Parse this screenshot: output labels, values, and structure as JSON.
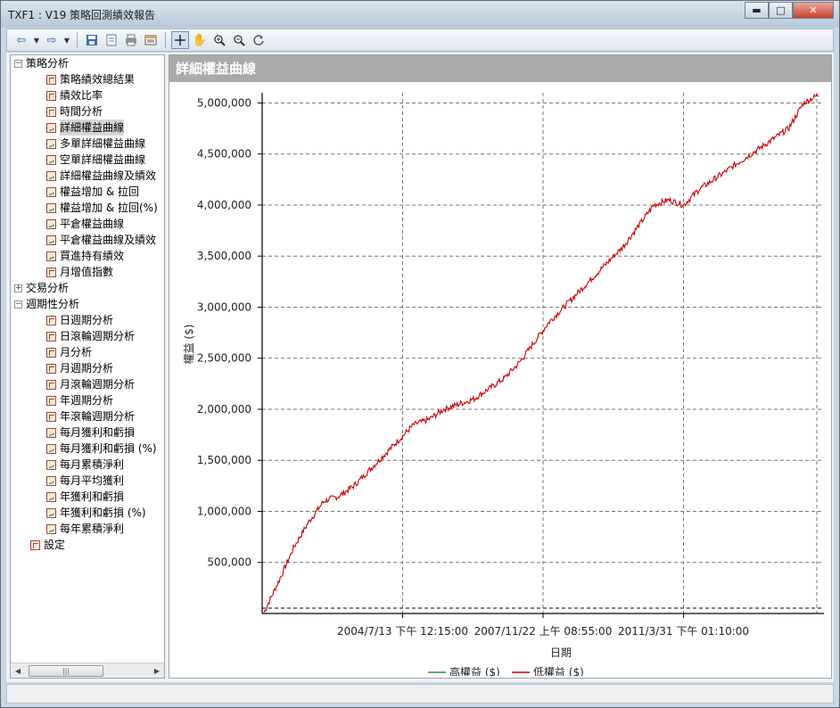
{
  "window": {
    "title": "TXF1 : V19 策略回測績效報告"
  },
  "window_buttons": {
    "minimize": "▬",
    "maximize": "□",
    "close": "✕"
  },
  "toolbar": {
    "icons": [
      "back-icon",
      "forward-icon",
      "save-icon",
      "export-icon",
      "print-icon",
      "settings-icon",
      "crosshair-icon",
      "hand-icon",
      "zoom-in-icon",
      "zoom-out-icon",
      "reset-icon"
    ]
  },
  "tree": {
    "groups": [
      {
        "label": "策略分析",
        "expanded": true,
        "items": [
          {
            "label": "策略績效總結果",
            "icon": "table"
          },
          {
            "label": "績效比率",
            "icon": "table"
          },
          {
            "label": "時間分析",
            "icon": "table"
          },
          {
            "label": "詳細權益曲線",
            "icon": "chart",
            "selected": true
          },
          {
            "label": "多單詳細權益曲線",
            "icon": "chart"
          },
          {
            "label": "空單詳細權益曲線",
            "icon": "chart"
          },
          {
            "label": "詳細權益曲線及績效",
            "icon": "chart"
          },
          {
            "label": "權益增加 & 拉回",
            "icon": "chart"
          },
          {
            "label": "權益增加 & 拉回(%)",
            "icon": "chart"
          },
          {
            "label": "平倉權益曲線",
            "icon": "chart"
          },
          {
            "label": "平倉權益曲線及績效",
            "icon": "chart"
          },
          {
            "label": "買進持有績效",
            "icon": "chart"
          },
          {
            "label": "月增值指數",
            "icon": "table"
          }
        ]
      },
      {
        "label": "交易分析",
        "expanded": false,
        "items": []
      },
      {
        "label": "週期性分析",
        "expanded": true,
        "items": [
          {
            "label": "日週期分析",
            "icon": "table"
          },
          {
            "label": "日滾輪週期分析",
            "icon": "table"
          },
          {
            "label": "月分析",
            "icon": "table"
          },
          {
            "label": "月週期分析",
            "icon": "table"
          },
          {
            "label": "月滾輪週期分析",
            "icon": "table"
          },
          {
            "label": "年週期分析",
            "icon": "table"
          },
          {
            "label": "年滾輪週期分析",
            "icon": "table"
          },
          {
            "label": "每月獲利和虧損",
            "icon": "chart"
          },
          {
            "label": "每月獲利和虧損 (%)",
            "icon": "chart"
          },
          {
            "label": "每月累積淨利",
            "icon": "chart"
          },
          {
            "label": "每月平均獲利",
            "icon": "chart"
          },
          {
            "label": "年獲利和虧損",
            "icon": "chart"
          },
          {
            "label": "年獲利和虧損 (%)",
            "icon": "chart"
          },
          {
            "label": "每年累積淨利",
            "icon": "chart"
          }
        ]
      }
    ],
    "settings_label": "設定",
    "scroll_left": "◀",
    "scroll_right": "▶",
    "thumb_grip": "|||"
  },
  "panel": {
    "title": "詳細權益曲線"
  },
  "chart_data": {
    "type": "line",
    "title": "",
    "xlabel": "日期",
    "ylabel": "權益 ($)",
    "ylim": [
      0,
      5100000
    ],
    "yticks": [
      500000,
      1000000,
      1500000,
      2000000,
      2500000,
      3000000,
      3500000,
      4000000,
      4500000,
      5000000
    ],
    "ytick_labels": [
      "500,000",
      "1,000,000",
      "1,500,000",
      "2,000,000",
      "2,500,000",
      "3,000,000",
      "3,500,000",
      "4,000,000",
      "4,500,000",
      "5,000,000"
    ],
    "xtick_labels": [
      "2004/7/13 下午 12:15:00",
      "2007/11/22 上午 08:55:00",
      "2011/3/31 下午 01:10:00"
    ],
    "x_tick_positions": [
      0.25,
      0.5,
      0.75
    ],
    "grid": true,
    "legend_position": "bottom",
    "series": [
      {
        "name": "高權益 ($)",
        "color": "#2e8b2e",
        "values": []
      },
      {
        "name": "低權益 ($)",
        "color": "#cc0000",
        "values": [
          10000,
          320000,
          650000,
          900000,
          1100000,
          1150000,
          1250000,
          1400000,
          1550000,
          1700000,
          1850000,
          1900000,
          2000000,
          2050000,
          2100000,
          2200000,
          2300000,
          2450000,
          2650000,
          2850000,
          3000000,
          3150000,
          3300000,
          3450000,
          3600000,
          3800000,
          4000000,
          4050000,
          4000000,
          4150000,
          4250000,
          4350000,
          4450000,
          4550000,
          4650000,
          4750000,
          5000000,
          5080000
        ]
      }
    ]
  }
}
